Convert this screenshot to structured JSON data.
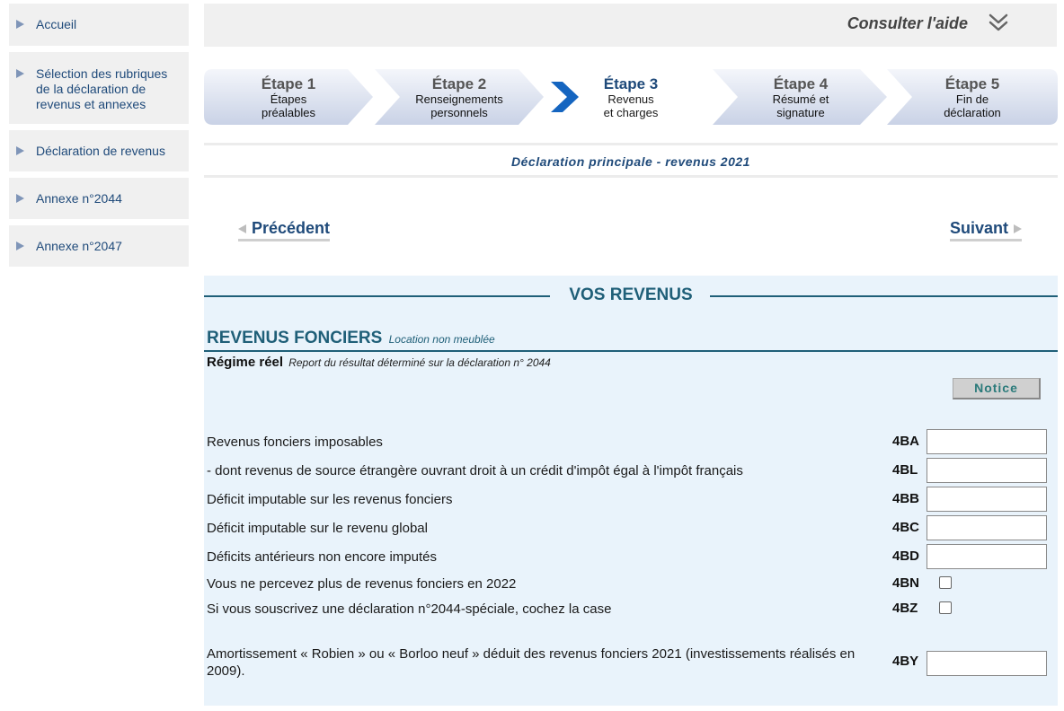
{
  "sidebar": {
    "items": [
      {
        "label": "Accueil"
      },
      {
        "label": "Sélection des rubriques de la déclaration de revenus et annexes"
      },
      {
        "label": "Déclaration de revenus"
      },
      {
        "label": "Annexe n°2044"
      },
      {
        "label": "Annexe n°2047"
      }
    ]
  },
  "header": {
    "help_label": "Consulter l'aide",
    "help_icon": "double-chevron-down-icon"
  },
  "steps": [
    {
      "title": "Étape 1",
      "sub1": "Étapes",
      "sub2": "préalables"
    },
    {
      "title": "Étape 2",
      "sub1": "Renseignements",
      "sub2": "personnels"
    },
    {
      "title": "Étape 3",
      "sub1": "Revenus",
      "sub2": "et charges",
      "active": true
    },
    {
      "title": "Étape 4",
      "sub1": "Résumé et",
      "sub2": "signature"
    },
    {
      "title": "Étape 5",
      "sub1": "Fin de",
      "sub2": "déclaration"
    }
  ],
  "subtitle": "Déclaration principale - revenus 2021",
  "nav": {
    "prev_label": "Précédent",
    "next_label": "Suivant"
  },
  "section": {
    "title": "VOS REVENUS",
    "heading": "REVENUS FONCIERS",
    "heading_sub": "Location non meublée",
    "regime": "Régime réel",
    "regime_sub": "Report du résultat déterminé sur la déclaration n° 2044",
    "notice_label": "Notice"
  },
  "fields": [
    {
      "label": "Revenus fonciers imposables",
      "code": "4BA",
      "type": "input",
      "value": ""
    },
    {
      "label": "- dont revenus de source étrangère ouvrant droit à un crédit d'impôt égal à l'impôt français",
      "code": "4BL",
      "type": "input",
      "value": ""
    },
    {
      "label": "Déficit imputable sur les revenus fonciers",
      "code": "4BB",
      "type": "input",
      "value": ""
    },
    {
      "label": "Déficit imputable sur le revenu global",
      "code": "4BC",
      "type": "input",
      "value": ""
    },
    {
      "label": "Déficits antérieurs non encore imputés",
      "code": "4BD",
      "type": "input",
      "value": ""
    },
    {
      "label": "Vous ne percevez plus de revenus fonciers en 2022",
      "code": "4BN",
      "type": "checkbox",
      "checked": false
    },
    {
      "label": "Si vous souscrivez une déclaration n°2044-spéciale, cochez la case",
      "code": "4BZ",
      "type": "checkbox",
      "checked": false
    },
    {
      "label": "Amortissement « Robien » ou « Borloo neuf » déduit des revenus fonciers 2021 (investissements réalisés en 2009).",
      "code": "4BY",
      "type": "input",
      "value": ""
    }
  ],
  "colors": {
    "accent": "#1f5f78",
    "link": "#1f4a7a",
    "panel_bg": "#e9f3fb",
    "step_active_arrow": "#1565c0"
  }
}
